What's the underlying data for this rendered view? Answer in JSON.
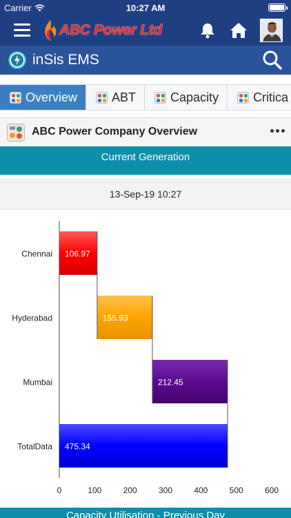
{
  "status_bar": {
    "carrier": "Carrier",
    "time": "10:27 AM"
  },
  "header": {
    "brand": "ABC Power Ltd",
    "icons": [
      "menu-icon",
      "bell-icon",
      "home-icon",
      "user-avatar"
    ]
  },
  "subheader": {
    "title": "inSis EMS",
    "icons": [
      "insis-logo-icon",
      "search-icon"
    ]
  },
  "tabs": [
    {
      "label": "Overview",
      "active": true
    },
    {
      "label": "ABT",
      "active": false
    },
    {
      "label": "Capacity",
      "active": false
    },
    {
      "label": "Critica",
      "active": false
    }
  ],
  "panel": {
    "title": "ABC Power Company Overview",
    "more_icon": "more-dots-icon"
  },
  "current_generation": {
    "title": "Current Generation",
    "timestamp": "13-Sep-19 10:27"
  },
  "chart_data": {
    "type": "bar",
    "orientation": "horizontal",
    "style": "waterfall",
    "categories": [
      "Chennai",
      "Hyderabad",
      "Mumbai",
      "TotalData"
    ],
    "values": [
      106.97,
      155.93,
      212.45,
      475.34
    ],
    "value_labels": [
      "106.97",
      "155.93",
      "212.45",
      "475.34"
    ],
    "colors": [
      "#ff0000",
      "#ffa500",
      "#5a0a8f",
      "#0000ff"
    ],
    "xlim": [
      0,
      600
    ],
    "xticks": [
      "0",
      "100",
      "200",
      "300",
      "400",
      "500",
      "600"
    ],
    "grid": false
  },
  "bottom_section": {
    "title": "Capacity Utilisation - Previous Day"
  }
}
